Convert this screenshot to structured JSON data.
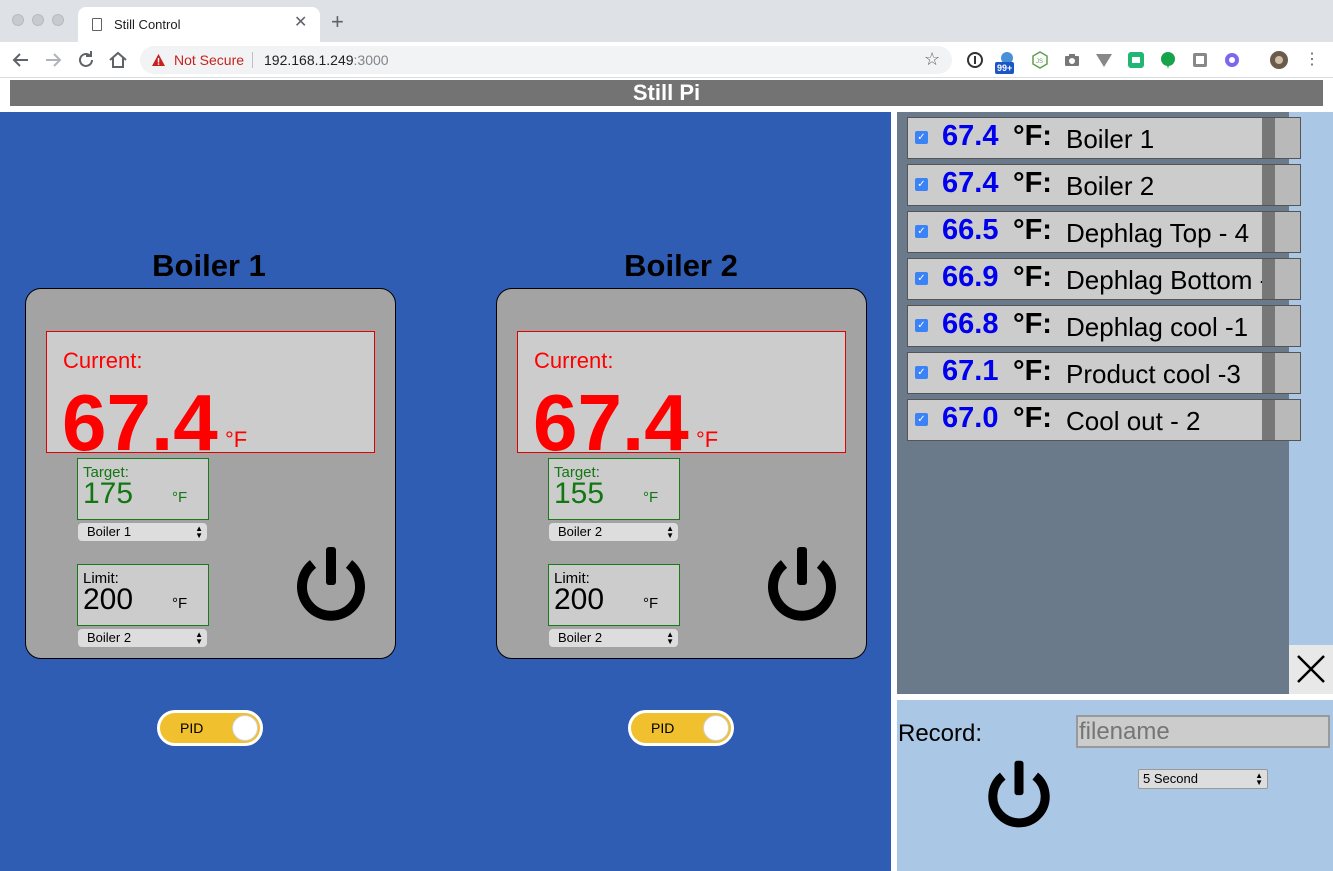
{
  "browser": {
    "tab_title": "Still Control",
    "security_label": "Not Secure",
    "url_host": "192.168.1.249",
    "url_port": ":3000",
    "ext_badge": "99+"
  },
  "page": {
    "header_title": "Still Pi"
  },
  "boilers": [
    {
      "title": "Boiler 1",
      "current_label": "Current:",
      "current_value": "67.4",
      "current_unit": "°F",
      "target_label": "Target:",
      "target_value": "175",
      "target_unit": "°F",
      "target_sensor": "Boiler 1",
      "limit_label": "Limit:",
      "limit_value": "200",
      "limit_unit": "°F",
      "limit_sensor": "Boiler 2",
      "pid_label": "PID"
    },
    {
      "title": "Boiler 2",
      "current_label": "Current:",
      "current_value": "67.4",
      "current_unit": "°F",
      "target_label": "Target:",
      "target_value": "155",
      "target_unit": "°F",
      "target_sensor": "Boiler 2",
      "limit_label": "Limit:",
      "limit_value": "200",
      "limit_unit": "°F",
      "limit_sensor": "Boiler 2",
      "pid_label": "PID"
    }
  ],
  "sensors": [
    {
      "value": "67.4",
      "unit": "°F:",
      "name": "Boiler 1"
    },
    {
      "value": "67.4",
      "unit": "°F:",
      "name": "Boiler 2"
    },
    {
      "value": "66.5",
      "unit": "°F:",
      "name": "Dephlag Top - 4"
    },
    {
      "value": "66.9",
      "unit": "°F:",
      "name": "Dephlag Bottom -"
    },
    {
      "value": "66.8",
      "unit": "°F:",
      "name": "Dephlag cool -1"
    },
    {
      "value": "67.1",
      "unit": "°F:",
      "name": "Product cool -3"
    },
    {
      "value": "67.0",
      "unit": "°F:",
      "name": "Cool out - 2"
    }
  ],
  "record": {
    "label": "Record:",
    "filename_placeholder": "filename",
    "interval": "5 Second"
  },
  "colors": {
    "main_bg": "#305db4",
    "side_bg": "#aac7e6",
    "current_red": "#ff0000",
    "target_green": "#117711",
    "sensor_blue": "#0000ee",
    "pid_yellow": "#f0c02e"
  }
}
